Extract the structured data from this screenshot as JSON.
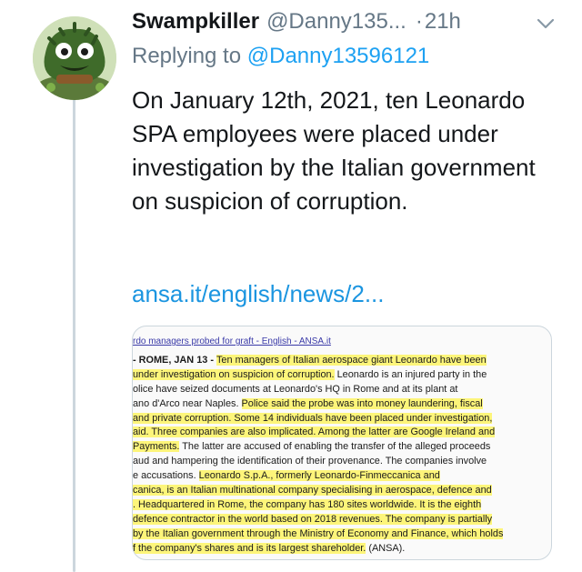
{
  "tweet": {
    "display_name": "Swampkiller",
    "handle": "@Danny135...",
    "separator": "·",
    "time": "21h",
    "replying_prefix": "Replying to",
    "replying_to": "@Danny13596121",
    "text": "On January 12th, 2021, ten Leonardo SPA employees were placed under investigation by the Italian government on suspicion of corruption.",
    "link": "ansa.it/english/news/2..."
  },
  "card": {
    "title": "rdo managers probed for graft - English - ANSA.it",
    "lines": [
      [
        {
          "t": "- ROME, JAN 13 - ",
          "b": true
        },
        {
          "t": "Ten managers of Italian aerospace giant Leonardo have been",
          "h": true
        }
      ],
      [
        {
          "t": "under investigation on suspicion of corruption.",
          "h": true
        },
        {
          "t": " Leonardo is an injured party in the"
        }
      ],
      [
        {
          "t": "olice have seized documents at Leonardo's HQ in Rome and at its plant at"
        }
      ],
      [
        {
          "t": "ano d'Arco near Naples. "
        },
        {
          "t": "Police said the probe was into money laundering, fiscal",
          "h": true
        }
      ],
      [
        {
          "t": "and private corruption. Some 14 individuals have been placed under investigation,",
          "h": true
        }
      ],
      [
        {
          "t": "aid. Three companies are also implicated. Among the latter are Google Ireland and",
          "h": true
        }
      ],
      [
        {
          "t": "Payments.",
          "h": true
        },
        {
          "t": " The latter are accused of enabling the transfer of the alleged proceeds"
        }
      ],
      [
        {
          "t": "aud and hampering the identification of their provenance. The companies involve"
        }
      ],
      [
        {
          "t": "e accusations. "
        },
        {
          "t": "Leonardo S.p.A., formerly Leonardo-Finmeccanica and",
          "h": true
        }
      ],
      [
        {
          "t": "canica, is an Italian multinational company specialising in aerospace, defence and",
          "h": true
        }
      ],
      [
        {
          "t": ". Headquartered in Rome, the company has 180 sites worldwide. It is the eighth",
          "h": true
        }
      ],
      [
        {
          "t": "defence contractor in the world based on 2018 revenues. The company is partially",
          "h": true
        }
      ],
      [
        {
          "t": "by the Italian government through the Ministry of Economy and Finance, which holds",
          "h": true
        }
      ],
      [
        {
          "t": "f the company's shares and is its largest shareholder.",
          "h": true
        },
        {
          "t": " (ANSA)."
        }
      ]
    ]
  },
  "colors": {
    "accent": "#1da1f2",
    "secondary_text": "#657786",
    "highlight": "#fdf57a"
  },
  "icons": {
    "caret": "chevron-down-icon",
    "avatar": "swamp-creature-avatar"
  }
}
